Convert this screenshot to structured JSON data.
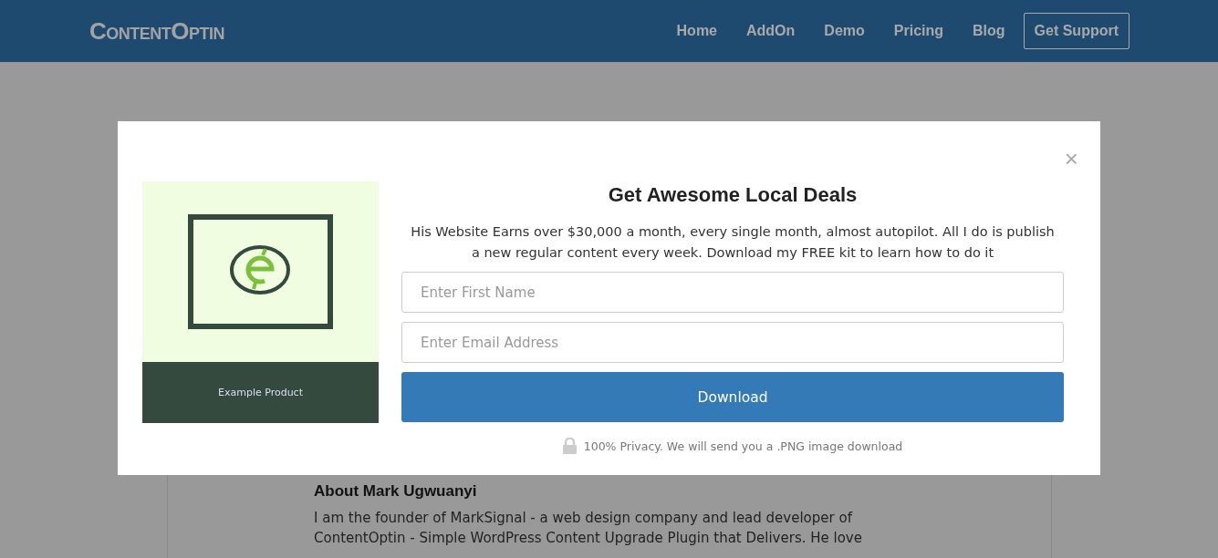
{
  "header": {
    "logo": "ContentOptin",
    "nav": [
      {
        "label": "Home",
        "kind": "link"
      },
      {
        "label": "AddOn",
        "kind": "link"
      },
      {
        "label": "Demo",
        "kind": "link"
      },
      {
        "label": "Pricing",
        "kind": "link"
      },
      {
        "label": "Blog",
        "kind": "link"
      },
      {
        "label": "Get Support",
        "kind": "outlined"
      }
    ]
  },
  "about": {
    "title": "About Mark Ugwuanyi",
    "text": "I am the founder of MarkSignal - a web design company and lead developer of ContentOptin - Simple WordPress Content Upgrade Plugin that Delivers. He love"
  },
  "modal": {
    "close": "×",
    "product_caption": "Example Product",
    "title": "Get Awesome Local Deals",
    "description": "His Website Earns over $30,000 a month, every single month, almost autopilot. All I do is publish a new regular content every week. Download my FREE kit to learn how to do it",
    "fields": [
      {
        "placeholder": "Enter First Name"
      },
      {
        "placeholder": "Enter Email Address"
      }
    ],
    "button": "Download",
    "privacy": "100% Privacy. We will send you a .PNG image download"
  }
}
